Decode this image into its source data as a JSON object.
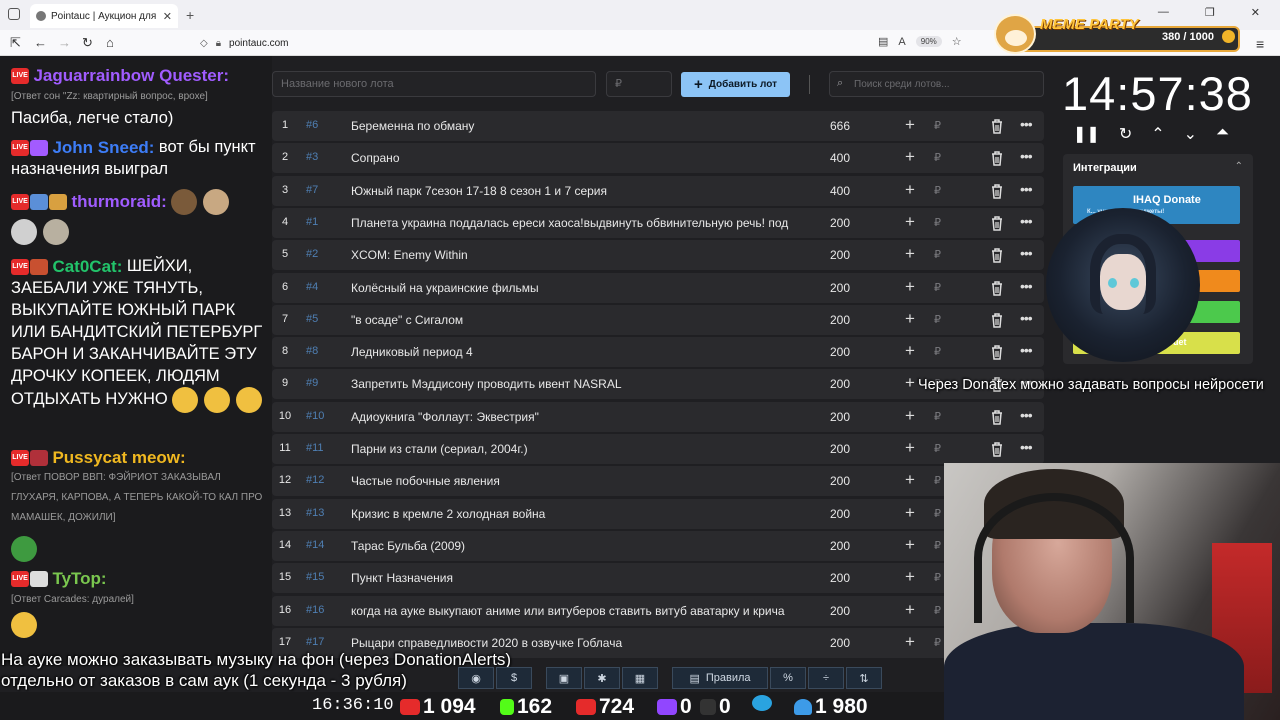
{
  "browser": {
    "tab_title": "Pointauc | Аукцион для стрим",
    "url": "pointauc.com",
    "zoom": "90%"
  },
  "meme_party": {
    "title": "MEME PARTY",
    "count": "380 / 1000"
  },
  "chat": [
    {
      "user": "Jaguarrainbow Quester:",
      "color": "#a05cff",
      "reply": "[Ответ сон \"Zz: квартирный вопрос, врохе]",
      "text": "Пасиба, легче стало)"
    },
    {
      "user": "John Sneed:",
      "color": "#3d7df7",
      "text": "вот бы пункт назначения выиграл"
    },
    {
      "user": "thurmoraid:",
      "color": "#a05cff",
      "text": ""
    },
    {
      "user": "Cat0Cat:",
      "color": "#22c36a",
      "text": "ШЕЙХИ, ЗАЕБАЛИ УЖЕ ТЯНУТЬ, ВЫКУПАЙТЕ ЮЖНЫЙ ПАРК ИЛИ БАНДИТСКИЙ ПЕТЕРБУРГ БАРОН И ЗАКАНЧИВАЙТЕ ЭТУ ДРОЧКУ КОПЕЕК, ЛЮДЯМ ОТДЫХАТЬ НУЖНО"
    },
    {
      "user": "Pussycat meow:",
      "color": "#f0b820",
      "reply": "[Ответ ПОВОР ВВП: ФЭЙРИОТ ЗАКАЗЫВАЛ ГЛУХАРЯ, КАРПОВА, А ТЕПЕРЬ КАКОЙ-ТО КАЛ ПРО МАМАШЕК, ДОЖИЛИ]"
    },
    {
      "user": "TyTop:",
      "color": "#7ac74f",
      "reply": "[Ответ Carcades: дуралей]"
    }
  ],
  "controls": {
    "lot_name_placeholder": "Название нового лота",
    "price_placeholder": "₽",
    "add_button": "Добавить лот",
    "search_placeholder": "Поиск среди лотов..."
  },
  "lots": [
    {
      "n": "1",
      "id": "#6",
      "name": "Беременна по обману",
      "amount": "666"
    },
    {
      "n": "2",
      "id": "#3",
      "name": "Сопрано",
      "amount": "400"
    },
    {
      "n": "3",
      "id": "#7",
      "name": "Южный парк 7сезон 17-18 8 сезон 1 и 7 серия",
      "amount": "400"
    },
    {
      "n": "4",
      "id": "#1",
      "name": "Планета украина поддалась ереси хаоса!выдвинуть обвинительную речь! под",
      "amount": "200"
    },
    {
      "n": "5",
      "id": "#2",
      "name": "XCOM: Enemy Within",
      "amount": "200"
    },
    {
      "n": "6",
      "id": "#4",
      "name": "Колёсный на украинские фильмы",
      "amount": "200"
    },
    {
      "n": "7",
      "id": "#5",
      "name": "\"в осаде\" с Сигалом",
      "amount": "200"
    },
    {
      "n": "8",
      "id": "#8",
      "name": "Ледниковый период 4",
      "amount": "200"
    },
    {
      "n": "9",
      "id": "#9",
      "name": "Запретить Мэддисону проводить ивент NASRAL",
      "amount": "200"
    },
    {
      "n": "10",
      "id": "#10",
      "name": "Адиоукнига \"Фоллаут: Эквестрия\"",
      "amount": "200"
    },
    {
      "n": "11",
      "id": "#11",
      "name": "Парни из стали (сериал, 2004г.)",
      "amount": "200"
    },
    {
      "n": "12",
      "id": "#12",
      "name": "Частые побочные явления",
      "amount": "200"
    },
    {
      "n": "13",
      "id": "#13",
      "name": "Кризис в кремле 2 холодная война",
      "amount": "200"
    },
    {
      "n": "14",
      "id": "#14",
      "name": "Тарас Бульба (2009)",
      "amount": "200"
    },
    {
      "n": "15",
      "id": "#15",
      "name": "Пункт Назначения",
      "amount": "200"
    },
    {
      "n": "16",
      "id": "#16",
      "name": "когда на ауке выкупают аниме или витуберов ставить витуб аватарку и крича",
      "amount": "200"
    },
    {
      "n": "17",
      "id": "#17",
      "name": "Рыцари справедливости 2020 в озвучке Гоблача",
      "amount": "200"
    }
  ],
  "timer": {
    "value": "14:57:38"
  },
  "integrations": {
    "title": "Интеграции",
    "donate_label": "IHAQ Donate",
    "donate_sub": "К... уникальные виджеты!",
    "button_colors": [
      "#2e86c1",
      "#8a3ce6",
      "#f08a1c",
      "#4cc94c",
      "#d8e04a"
    ],
    "last_label": "uet"
  },
  "overlays": {
    "donatex_text": "Через Donatex можно задавать вопросы нейросети",
    "music_line1": "На ауке можно заказывать музыку на фон (через DonationAlerts)",
    "music_line2": "отдельно от заказов в сам аук (1 секунда - 3 рубля)"
  },
  "toolbar": {
    "rules_label": "Правила"
  },
  "status": {
    "clock": "16:36:10",
    "youtube": "1 094",
    "kick": "162",
    "vklive": "724",
    "twitch": "0",
    "rutube": "0",
    "viewers": "1 980"
  }
}
